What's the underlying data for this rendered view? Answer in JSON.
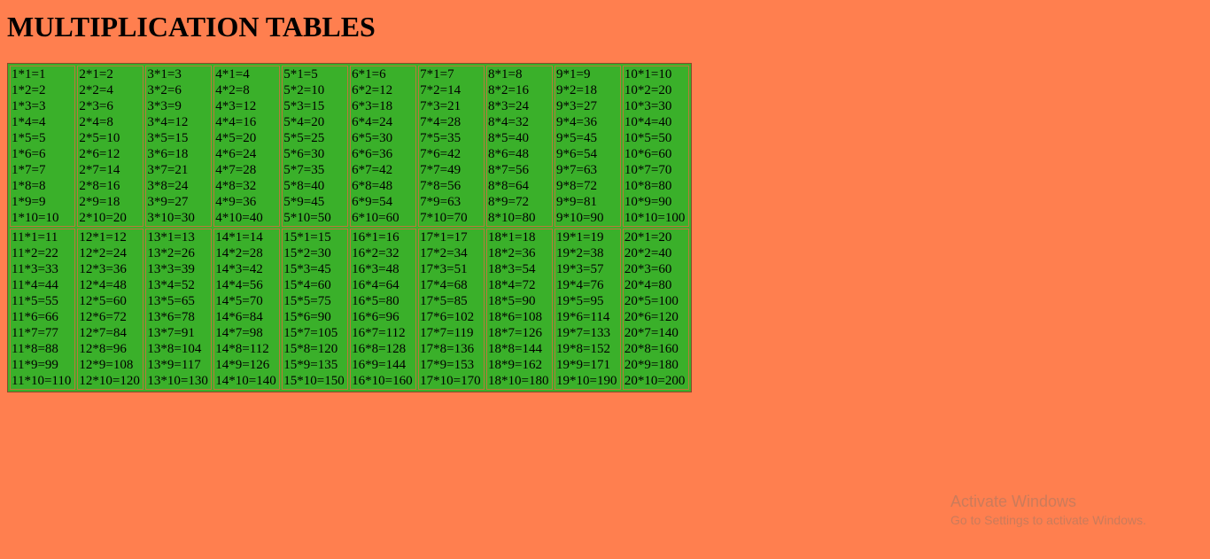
{
  "page": {
    "title": "MULTIPLICATION TABLES",
    "background_color": "#ff7f4f",
    "cell_color": "#3ab02a"
  },
  "table": {
    "rows": [
      [
        [
          "1*1=1",
          "1*2=2",
          "1*3=3",
          "1*4=4",
          "1*5=5",
          "1*6=6",
          "1*7=7",
          "1*8=8",
          "1*9=9",
          "1*10=10"
        ],
        [
          "2*1=2",
          "2*2=4",
          "2*3=6",
          "2*4=8",
          "2*5=10",
          "2*6=12",
          "2*7=14",
          "2*8=16",
          "2*9=18",
          "2*10=20"
        ],
        [
          "3*1=3",
          "3*2=6",
          "3*3=9",
          "3*4=12",
          "3*5=15",
          "3*6=18",
          "3*7=21",
          "3*8=24",
          "3*9=27",
          "3*10=30"
        ],
        [
          "4*1=4",
          "4*2=8",
          "4*3=12",
          "4*4=16",
          "4*5=20",
          "4*6=24",
          "4*7=28",
          "4*8=32",
          "4*9=36",
          "4*10=40"
        ],
        [
          "5*1=5",
          "5*2=10",
          "5*3=15",
          "5*4=20",
          "5*5=25",
          "5*6=30",
          "5*7=35",
          "5*8=40",
          "5*9=45",
          "5*10=50"
        ],
        [
          "6*1=6",
          "6*2=12",
          "6*3=18",
          "6*4=24",
          "6*5=30",
          "6*6=36",
          "6*7=42",
          "6*8=48",
          "6*9=54",
          "6*10=60"
        ],
        [
          "7*1=7",
          "7*2=14",
          "7*3=21",
          "7*4=28",
          "7*5=35",
          "7*6=42",
          "7*7=49",
          "7*8=56",
          "7*9=63",
          "7*10=70"
        ],
        [
          "8*1=8",
          "8*2=16",
          "8*3=24",
          "8*4=32",
          "8*5=40",
          "8*6=48",
          "8*7=56",
          "8*8=64",
          "8*9=72",
          "8*10=80"
        ],
        [
          "9*1=9",
          "9*2=18",
          "9*3=27",
          "9*4=36",
          "9*5=45",
          "9*6=54",
          "9*7=63",
          "9*8=72",
          "9*9=81",
          "9*10=90"
        ],
        [
          "10*1=10",
          "10*2=20",
          "10*3=30",
          "10*4=40",
          "10*5=50",
          "10*6=60",
          "10*7=70",
          "10*8=80",
          "10*9=90",
          "10*10=100"
        ]
      ],
      [
        [
          "11*1=11",
          "11*2=22",
          "11*3=33",
          "11*4=44",
          "11*5=55",
          "11*6=66",
          "11*7=77",
          "11*8=88",
          "11*9=99",
          "11*10=110"
        ],
        [
          "12*1=12",
          "12*2=24",
          "12*3=36",
          "12*4=48",
          "12*5=60",
          "12*6=72",
          "12*7=84",
          "12*8=96",
          "12*9=108",
          "12*10=120"
        ],
        [
          "13*1=13",
          "13*2=26",
          "13*3=39",
          "13*4=52",
          "13*5=65",
          "13*6=78",
          "13*7=91",
          "13*8=104",
          "13*9=117",
          "13*10=130"
        ],
        [
          "14*1=14",
          "14*2=28",
          "14*3=42",
          "14*4=56",
          "14*5=70",
          "14*6=84",
          "14*7=98",
          "14*8=112",
          "14*9=126",
          "14*10=140"
        ],
        [
          "15*1=15",
          "15*2=30",
          "15*3=45",
          "15*4=60",
          "15*5=75",
          "15*6=90",
          "15*7=105",
          "15*8=120",
          "15*9=135",
          "15*10=150"
        ],
        [
          "16*1=16",
          "16*2=32",
          "16*3=48",
          "16*4=64",
          "16*5=80",
          "16*6=96",
          "16*7=112",
          "16*8=128",
          "16*9=144",
          "16*10=160"
        ],
        [
          "17*1=17",
          "17*2=34",
          "17*3=51",
          "17*4=68",
          "17*5=85",
          "17*6=102",
          "17*7=119",
          "17*8=136",
          "17*9=153",
          "17*10=170"
        ],
        [
          "18*1=18",
          "18*2=36",
          "18*3=54",
          "18*4=72",
          "18*5=90",
          "18*6=108",
          "18*7=126",
          "18*8=144",
          "18*9=162",
          "18*10=180"
        ],
        [
          "19*1=19",
          "19*2=38",
          "19*3=57",
          "19*4=76",
          "19*5=95",
          "19*6=114",
          "19*7=133",
          "19*8=152",
          "19*9=171",
          "19*10=190"
        ],
        [
          "20*1=20",
          "20*2=40",
          "20*3=60",
          "20*4=80",
          "20*5=100",
          "20*6=120",
          "20*7=140",
          "20*8=160",
          "20*9=180",
          "20*10=200"
        ]
      ]
    ]
  },
  "watermark": {
    "title": "Activate Windows",
    "subtitle": "Go to Settings to activate Windows."
  }
}
